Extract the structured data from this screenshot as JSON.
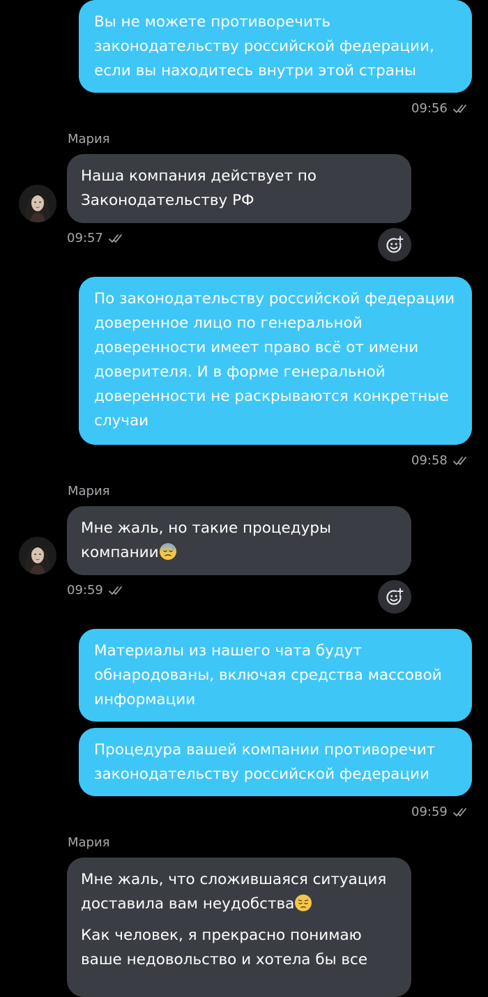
{
  "colors": {
    "background": "#000000",
    "outgoing_bubble": "#3ec6f7",
    "incoming_bubble": "#3b3d44",
    "meta_text": "#a6a8ad"
  },
  "messages": [
    {
      "direction": "outgoing",
      "lines": [
        "Вы не можете противоречить",
        "законодательству российской федерации,",
        "если вы находитесь внутри этой страны"
      ],
      "time": "09:56",
      "status_icon": "double-check-icon"
    },
    {
      "direction": "incoming",
      "sender": "Мария",
      "lines": [
        "Наша компания действует по",
        "Законодательству РФ"
      ],
      "time": "09:57",
      "status_icon": "double-check-icon"
    },
    {
      "direction": "outgoing",
      "lines": [
        "По законодательству российской федерации",
        "доверенное лицо по генеральной",
        "доверенности имеет право всё от имени",
        "доверителя. И в форме генеральной",
        "доверенности не раскрываются конкретные",
        "случаи"
      ],
      "time": "09:58",
      "status_icon": "double-check-icon"
    },
    {
      "direction": "incoming",
      "sender": "Мария",
      "lines": [
        "Мне жаль, но такие процедуры",
        "компании"
      ],
      "emoji": "anxious-sweat-face-icon",
      "time": "09:59",
      "status_icon": "double-check-icon"
    },
    {
      "direction": "outgoing",
      "lines": [
        "Материалы из нашего чата будут",
        "обнародованы, включая средства массовой",
        "информации"
      ]
    },
    {
      "direction": "outgoing",
      "lines": [
        "Процедура вашей компании противоречит",
        "законодательству российской федерации"
      ],
      "time": "09:59",
      "status_icon": "double-check-icon"
    },
    {
      "direction": "incoming",
      "sender": "Мария",
      "paragraphs": [
        [
          "Мне жаль, что сложившаяся ситуация",
          "доставила вам неудобства"
        ],
        [
          "Как человек, я прекрасно понимаю",
          "ваше недовольство и хотела бы все"
        ]
      ],
      "emoji": "pensive-face-icon"
    }
  ],
  "react_button_icon": "add-reaction-icon"
}
